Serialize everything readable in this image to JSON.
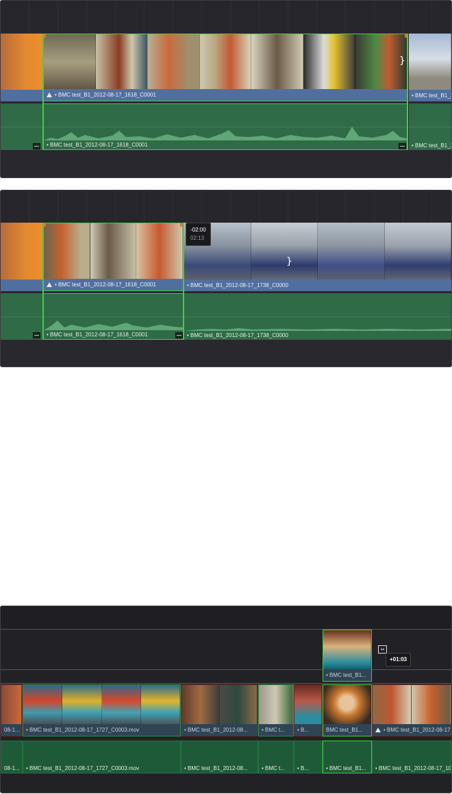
{
  "panel1": {
    "video_left_label": "",
    "video_main_label": "BMC test_B1_2012-08-17_1618_C0001",
    "video_right_label": "BMC test_B1_2",
    "audio_main_label": "BMC test_B1_2012-08-17_1618_C0001",
    "audio_right_label": "BMC test_B1_2"
  },
  "panel2": {
    "video_left_label": "BMC test_B1_2012-08-17_1618_C0001",
    "video_right_label": "BMC test_B1_2012-08-17_1738_C0000",
    "audio_left_label": "BMC test_B1_2012-08-17_1618_C0001",
    "audio_right_label": "BMC test_B1_2012-08-17_1738_C0000",
    "tooltip_offset": "-02:00",
    "tooltip_duration": "02:13"
  },
  "panel3": {
    "v2_clip_label": "BMC test_B1...",
    "move_tooltip": "+01:03",
    "v1_labels": [
      "08-1...",
      "BMC test_B1_2012-08-17_1727_C0003.mov",
      "BMC test_B1_2012-08...",
      "BMC t...",
      "B...",
      "BMC test_B1...",
      "BMC test_B1_2012-08-17"
    ],
    "a1_labels": [
      "08-1...",
      "BMC test_B1_2012-08-17_1727_C0003.mov",
      "BMC test_B1_2012-08...",
      "BMC t...",
      "B...",
      "BMC test_B1...",
      "BMC test_B1_2012-08-17_10"
    ]
  },
  "colors": {
    "video_label": "#516f9e",
    "audio_clip": "#2f6b47",
    "selection": "#3ad43a",
    "panel_bg": "#28282e"
  }
}
